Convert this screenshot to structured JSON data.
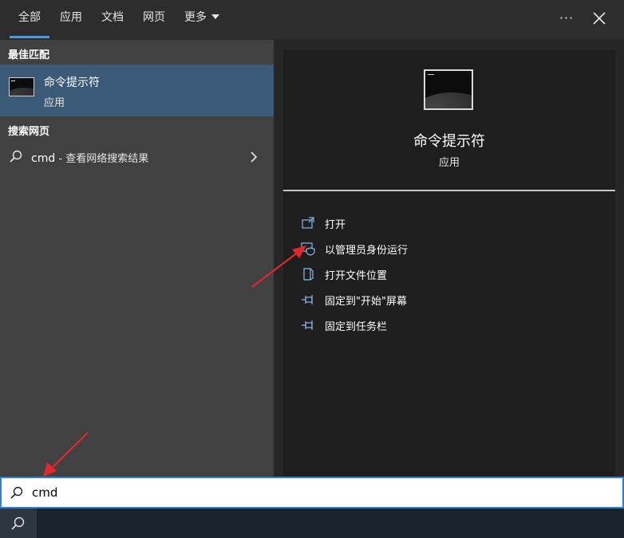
{
  "tabs": [
    {
      "label": "全部",
      "active": true
    },
    {
      "label": "应用",
      "active": false
    },
    {
      "label": "文档",
      "active": false
    },
    {
      "label": "网页",
      "active": false
    },
    {
      "label": "更多",
      "active": false,
      "has_dropdown": true
    }
  ],
  "window_controls": {
    "more": "···",
    "close_icon": "close-icon"
  },
  "left_pane": {
    "best_match_header": "最佳匹配",
    "best_match": {
      "title": "命令提示符",
      "subtitle": "应用",
      "icon": "cmd-terminal-icon"
    },
    "web_header": "搜索网页",
    "web_result": {
      "query": "cmd",
      "suffix": " - 查看网络搜索结果",
      "icon": "search-icon",
      "chevron": "chevron-right-icon"
    }
  },
  "detail": {
    "icon": "cmd-terminal-icon",
    "title": "命令提示符",
    "subtitle": "应用",
    "actions": [
      {
        "label": "打开",
        "icon": "open-icon"
      },
      {
        "label": "以管理员身份运行",
        "icon": "shield-admin-icon"
      },
      {
        "label": "打开文件位置",
        "icon": "file-location-icon"
      },
      {
        "label": "固定到\"开始\"屏幕",
        "icon": "pin-icon"
      },
      {
        "label": "固定到任务栏",
        "icon": "pin-icon"
      }
    ]
  },
  "search": {
    "value": "cmd",
    "icon": "search-icon"
  },
  "taskbar": {
    "search_icon": "search-icon"
  },
  "colors": {
    "accent": "#2f7fd6",
    "selected_item": "#3a5a78",
    "annotation_arrow": "#e0282d",
    "action_icon": "#8ab8e6"
  }
}
